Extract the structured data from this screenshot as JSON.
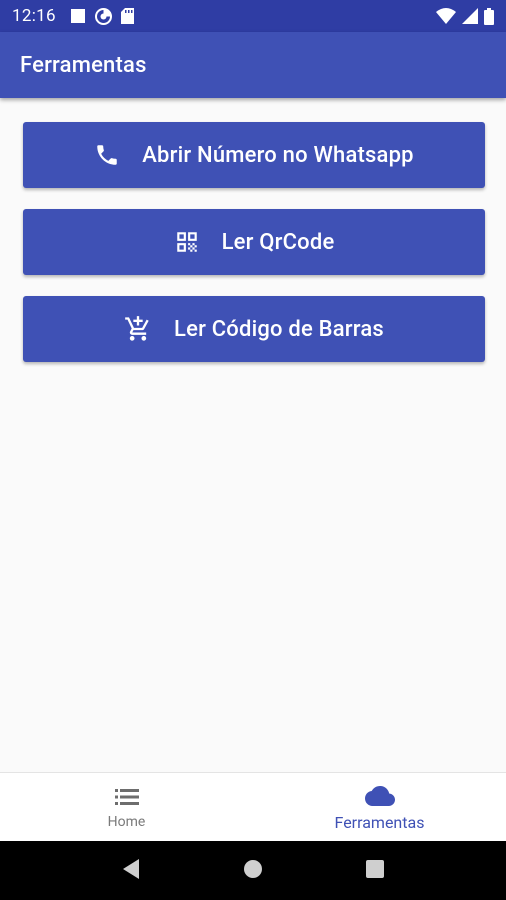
{
  "status_bar": {
    "time": "12:16",
    "icons_left": [
      "square-notification-icon",
      "data-saver-icon",
      "sd-card-icon"
    ],
    "icons_right": [
      "wifi-icon",
      "cell-signal-icon",
      "battery-icon"
    ]
  },
  "app_bar": {
    "title": "Ferramentas"
  },
  "tools": [
    {
      "label": "Abrir Número no Whatsapp",
      "icon": "phone-icon"
    },
    {
      "label": "Ler QrCode",
      "icon": "qr-code-icon"
    },
    {
      "label": "Ler Código de Barras",
      "icon": "add-shopping-cart-icon"
    }
  ],
  "bottom_nav": {
    "items": [
      {
        "label": "Home",
        "icon": "list-icon",
        "active": false
      },
      {
        "label": "Ferramentas",
        "icon": "cloud-icon",
        "active": true
      }
    ]
  },
  "colors": {
    "primary": "#3f51b5",
    "primary_dark": "#2f3da4",
    "background": "#fafafa",
    "inactive_nav": "#7a7a7a"
  },
  "system_nav": {
    "buttons": [
      "back-icon",
      "home-circle-icon",
      "recents-icon"
    ]
  }
}
